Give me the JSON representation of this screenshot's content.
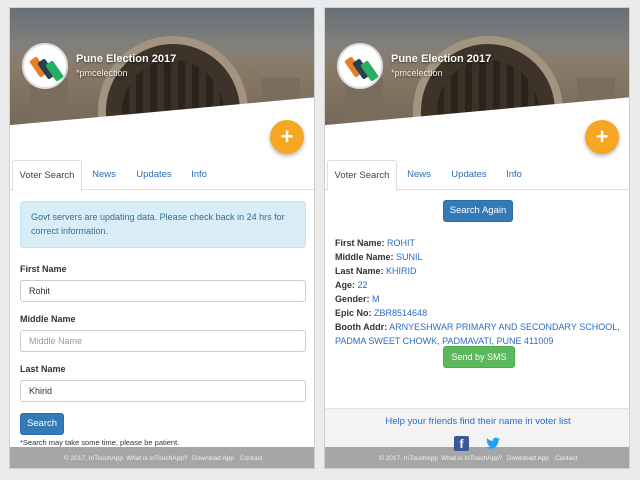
{
  "app": {
    "title": "Pune Election 2017",
    "handle": "*pmcelection",
    "fab_label": "+"
  },
  "tabs": [
    {
      "label": "Voter Search"
    },
    {
      "label": "News"
    },
    {
      "label": "Updates"
    },
    {
      "label": "Info"
    }
  ],
  "search_screen": {
    "alert": "Govt servers are updating data. Please check back in 24 hrs for correct information.",
    "first_name": {
      "label": "First Name",
      "value": "Rohit"
    },
    "middle_name": {
      "label": "Middle Name",
      "placeholder": "Middle Name",
      "value": ""
    },
    "last_name": {
      "label": "Last Name",
      "value": "Khirid"
    },
    "search_button": "Search",
    "note": "*Search may take some time, please be patient."
  },
  "result_screen": {
    "search_again_button": "Search Again",
    "fields": [
      {
        "label": "First Name:",
        "value": "ROHIT"
      },
      {
        "label": "Middle Name:",
        "value": "SUNIL"
      },
      {
        "label": "Last Name:",
        "value": "KHIRID"
      },
      {
        "label": "Age:",
        "value": "22"
      },
      {
        "label": "Gender:",
        "value": "M"
      },
      {
        "label": "Epic No:",
        "value": "ZBR8514648"
      },
      {
        "label": "Booth Addr:",
        "value": "ARNYESHWAR PRIMARY AND SECONDARY SCHOOL, PADMA SWEET CHOWK, PADMAVATI, PUNE 411009"
      }
    ],
    "sms_button": "Send by SMS",
    "help_text": "Help your friends find their name in voter list",
    "facebook_glyph": "f"
  },
  "footer": {
    "links": [
      "© 2017, InTouchApp",
      "What is InTouchApp?",
      "Download App",
      "Contact"
    ]
  },
  "colors": {
    "primary": "#337ab7",
    "success": "#5cb85c",
    "fab": "#f5a623",
    "alert_bg": "#d9edf7",
    "link": "#2a6ebb",
    "facebook": "#3b5998",
    "twitter": "#1da1f2"
  },
  "icons": [
    "app-logo-icon",
    "plus-icon",
    "facebook-icon",
    "twitter-icon"
  ]
}
